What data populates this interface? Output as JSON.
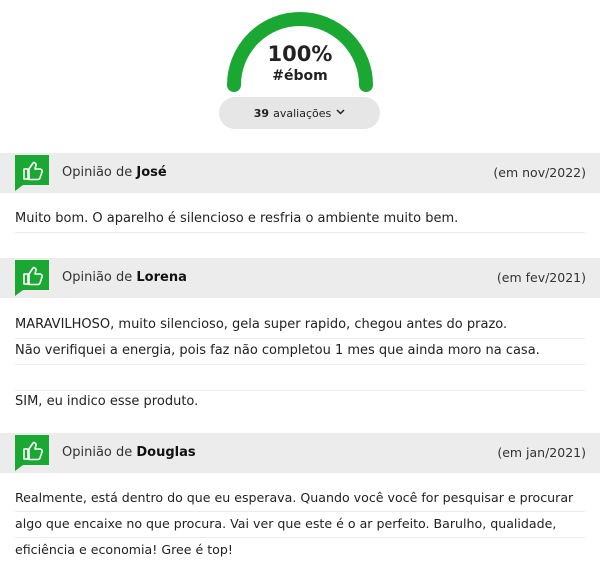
{
  "gauge": {
    "percent": "100%",
    "tag": "#ébom",
    "color": "#1ba832"
  },
  "reviews_summary": {
    "count": "39",
    "label": "avaliações",
    "chevron_icon": "chevron-down-icon"
  },
  "reviews": [
    {
      "prefix": "Opinião de ",
      "author": "José",
      "date": "(em nov/2022)",
      "icon": "thumbs-up-icon",
      "lines": [
        "Muito bom. O aparelho é silencioso e resfria o ambiente muito bem."
      ]
    },
    {
      "prefix": "Opinião de ",
      "author": "Lorena",
      "date": "(em fev/2021)",
      "icon": "thumbs-up-icon",
      "lines": [
        "MARAVILHOSO, muito silencioso, gela super rapido, chegou antes do prazo.",
        "Não verifiquei a energia, pois faz não completou 1 mes que ainda moro na casa.",
        "",
        "SIM, eu indico esse produto."
      ]
    },
    {
      "prefix": "Opinião de ",
      "author": "Douglas",
      "date": "(em jan/2021)",
      "icon": "thumbs-up-icon",
      "lines": [
        "Realmente, está dentro do que eu esperava. Quando você você for pesquisar e procurar",
        "algo que encaixe no que procura. Vai ver que este é o ar perfeito. Barulho, qualidade,",
        "eficiência e economia! Gree é top!"
      ]
    }
  ]
}
